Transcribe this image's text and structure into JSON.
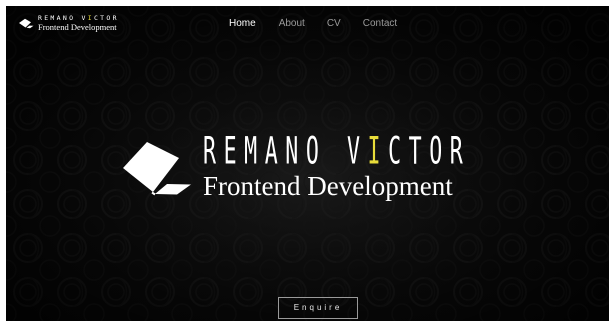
{
  "brand": {
    "name_before": "REMANO V",
    "name_highlight": "I",
    "name_after": "CTOR",
    "subtitle": "Frontend Development",
    "accent_color": "#e8dc3a",
    "logo_icon": "laptop-icon"
  },
  "nav": {
    "items": [
      {
        "label": "Home",
        "active": true
      },
      {
        "label": "About",
        "active": false
      },
      {
        "label": "CV",
        "active": false
      },
      {
        "label": "Contact",
        "active": false
      }
    ]
  },
  "hero": {
    "name_before": "REMANO V",
    "name_highlight": "I",
    "name_after": "CTOR",
    "subtitle": "Frontend Development"
  },
  "cta": {
    "label": "Enquire"
  },
  "colors": {
    "background": "#0c0c0c",
    "text": "#ffffff",
    "nav_inactive": "#9a9a9a",
    "accent": "#e8dc3a"
  }
}
